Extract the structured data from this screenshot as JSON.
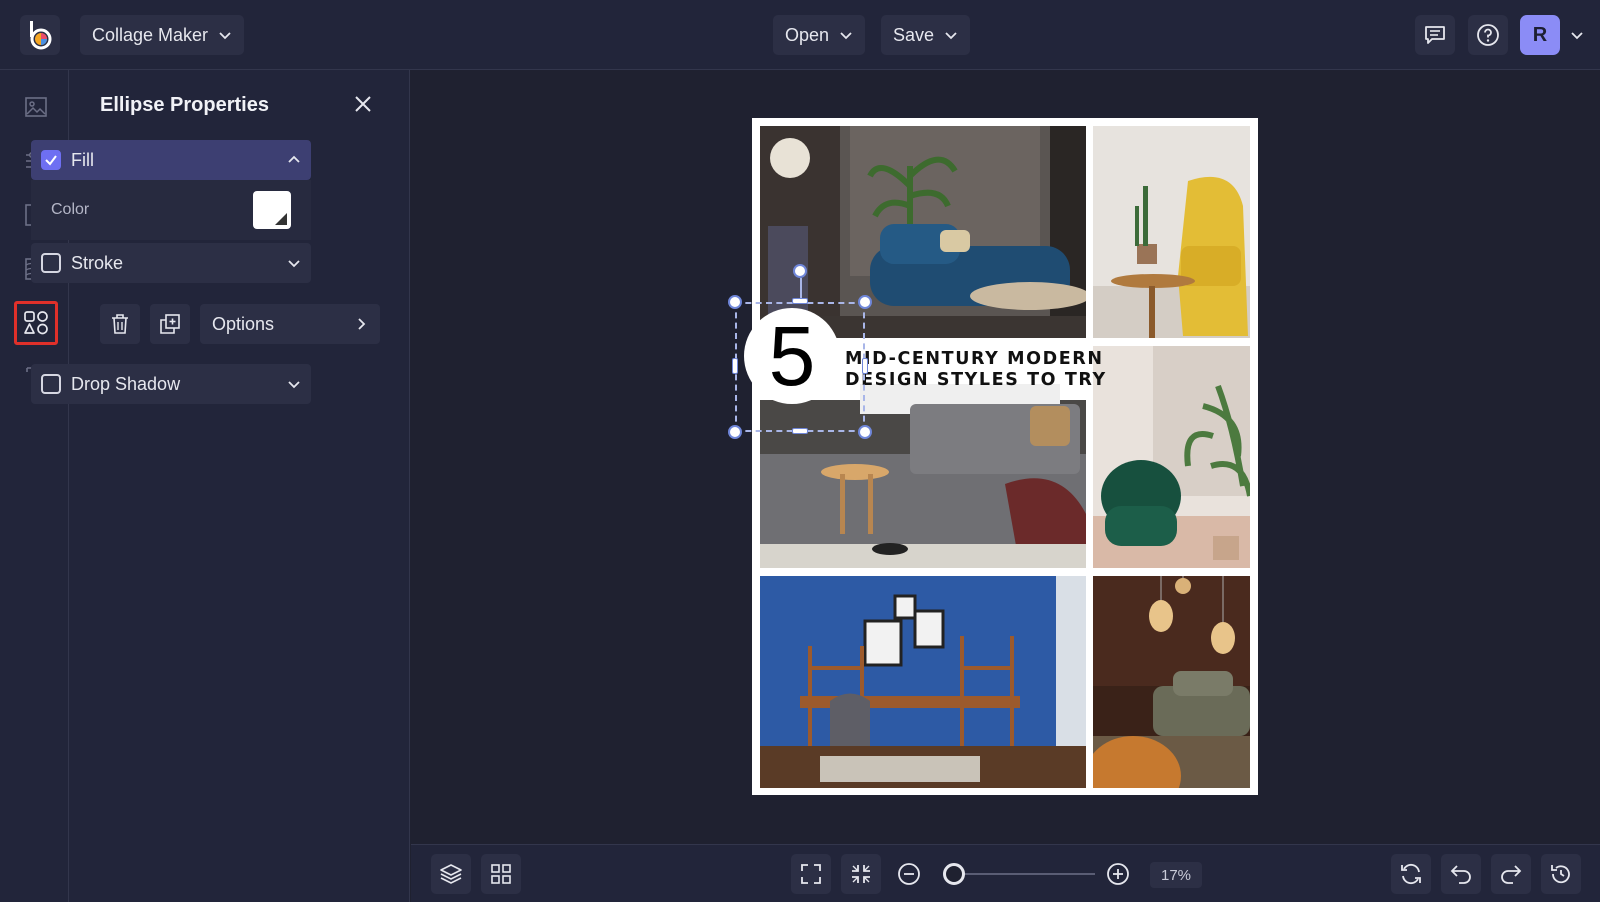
{
  "app": {
    "mode_label": "Collage Maker",
    "open_label": "Open",
    "save_label": "Save",
    "avatar_initial": "R"
  },
  "rail": {
    "items": [
      {
        "icon": "image-icon"
      },
      {
        "icon": "adjustments-icon"
      },
      {
        "icon": "layout-icon"
      },
      {
        "icon": "texture-icon"
      },
      {
        "icon": "shapes-icon",
        "active": true
      },
      {
        "icon": "text-icon"
      }
    ]
  },
  "panel": {
    "title": "Ellipse Properties",
    "fill_label": "Fill",
    "fill_checked": true,
    "color_label": "Color",
    "color_value": "#FFFFFF",
    "stroke_label": "Stroke",
    "stroke_checked": false,
    "options_label": "Options",
    "drop_shadow_label": "Drop Shadow",
    "drop_shadow_checked": false
  },
  "document": {
    "badge_number": "5",
    "headline_line1": "MID-CENTURY MODERN",
    "headline_line2": "DESIGN STYLES TO TRY"
  },
  "bottom": {
    "zoom_label": "17%",
    "zoom_value_percent": 17
  },
  "colors": {
    "accent": "#6E6FF2",
    "avatar": "#8B8CF6",
    "highlight": "#E0302A"
  }
}
